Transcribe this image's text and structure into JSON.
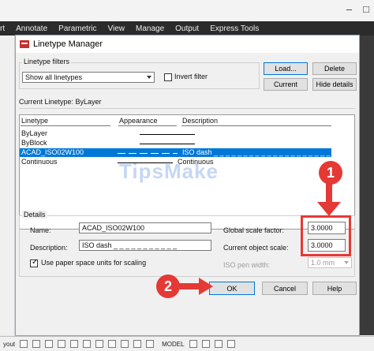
{
  "app": {
    "ribbon_tabs": [
      "rt",
      "Annotate",
      "Parametric",
      "View",
      "Manage",
      "Output",
      "Express Tools"
    ],
    "window_controls": [
      "–",
      "□"
    ],
    "status": {
      "model_label": "MODEL",
      "left_text": "yout"
    }
  },
  "dialog": {
    "title": "Linetype Manager",
    "filters": {
      "group_label": "Linetype filters",
      "select_value": "Show all linetypes",
      "invert_label": "Invert filter",
      "invert_checked": false
    },
    "buttons": {
      "load": "Load...",
      "delete": "Delete",
      "current": "Current",
      "hide_details": "Hide details",
      "ok": "OK",
      "cancel": "Cancel",
      "help": "Help"
    },
    "current_linetype_text": "Current Linetype:  ByLayer",
    "table": {
      "headers": [
        "Linetype",
        "Appearance",
        "Description"
      ],
      "rows": [
        {
          "name": "ByLayer",
          "appearance": "solid",
          "description": ""
        },
        {
          "name": "ByBlock",
          "appearance": "solid",
          "description": ""
        },
        {
          "name": "ACAD_ISO02W100",
          "appearance": "dash",
          "description": "ISO dash _ _ _ _ _ _ _ _ _ _ _ _ _ _ _ _ _ _ _ _ _ _",
          "selected": true
        },
        {
          "name": "Continuous",
          "appearance": "solid",
          "description": "Continuous"
        }
      ]
    },
    "details": {
      "group_label": "Details",
      "name_label": "Name:",
      "name_value": "ACAD_ISO02W100",
      "description_label": "Description:",
      "description_value": "ISO dash _ _ _ _ _ _ _ _ _ _ _",
      "paper_space_label": "Use paper space units for scaling",
      "paper_space_checked": true,
      "global_scale_label": "Global scale factor:",
      "global_scale_value": "3.0000",
      "current_scale_label": "Current object scale:",
      "current_scale_value": "3.0000",
      "iso_pen_label": "ISO pen width:",
      "iso_pen_value": "1.0 mm"
    }
  },
  "watermark": "TipsMake",
  "annotations": {
    "badge1": "1",
    "badge2": "2"
  },
  "colors": {
    "selection": "#0078d7",
    "annotation": "#e53935"
  }
}
